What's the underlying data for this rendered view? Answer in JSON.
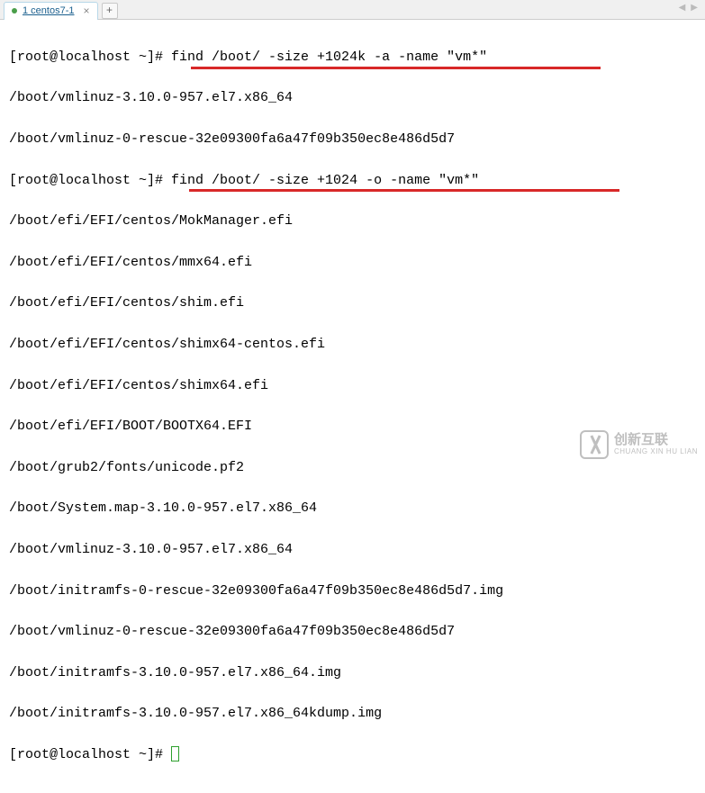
{
  "tab": {
    "label": "1 centos7-1",
    "close_glyph": "×",
    "add_glyph": "+"
  },
  "nav": {
    "left": "◀",
    "right": "▶"
  },
  "terminal": {
    "prompt": "[root@localhost ~]# ",
    "cmd1": "find /boot/ -size +1024k -a -name \"vm*\"",
    "out1": [
      "/boot/vmlinuz-3.10.0-957.el7.x86_64",
      "/boot/vmlinuz-0-rescue-32e09300fa6a47f09b350ec8e486d5d7"
    ],
    "cmd2": "find /boot/ -size +1024 -o -name \"vm*\"",
    "out2": [
      "/boot/efi/EFI/centos/MokManager.efi",
      "/boot/efi/EFI/centos/mmx64.efi",
      "/boot/efi/EFI/centos/shim.efi",
      "/boot/efi/EFI/centos/shimx64-centos.efi",
      "/boot/efi/EFI/centos/shimx64.efi",
      "/boot/efi/EFI/BOOT/BOOTX64.EFI",
      "/boot/grub2/fonts/unicode.pf2",
      "/boot/System.map-3.10.0-957.el7.x86_64",
      "/boot/vmlinuz-3.10.0-957.el7.x86_64",
      "/boot/initramfs-0-rescue-32e09300fa6a47f09b350ec8e486d5d7.img",
      "/boot/vmlinuz-0-rescue-32e09300fa6a47f09b350ec8e486d5d7",
      "/boot/initramfs-3.10.0-957.el7.x86_64.img",
      "/boot/initramfs-3.10.0-957.el7.x86_64kdump.img"
    ]
  },
  "watermark": {
    "cn": "创新互联",
    "en": "CHUANG XIN HU LIAN"
  }
}
